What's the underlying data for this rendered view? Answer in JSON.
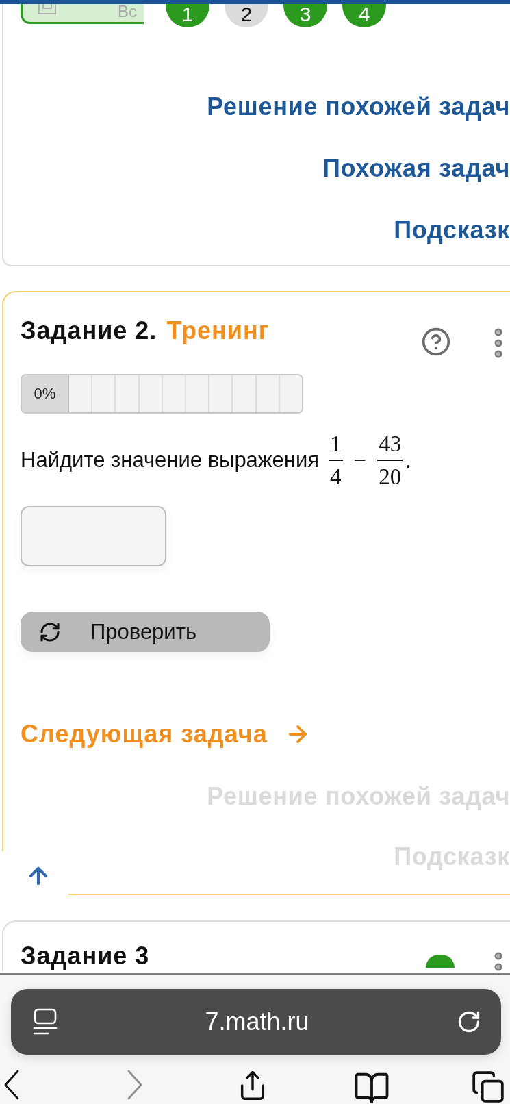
{
  "top_bar": {
    "tab": {
      "label": "Вс"
    },
    "task_numbers": [
      {
        "label": "1",
        "solved": true
      },
      {
        "label": "2",
        "solved": false
      },
      {
        "label": "3",
        "solved": true
      },
      {
        "label": "4",
        "solved": true
      }
    ]
  },
  "task_1": {
    "links": [
      {
        "label": "Решение похожей задач",
        "disabled": false
      },
      {
        "label": "Похожая задач",
        "disabled": false
      },
      {
        "label": "Подсказк",
        "disabled": false
      }
    ]
  },
  "task_2": {
    "title": "Задание 2.",
    "mode": "Тренинг",
    "progress": {
      "label": "0%",
      "segments": [
        {
          "filled": false
        },
        {
          "filled": false
        },
        {
          "filled": false
        },
        {
          "filled": false
        },
        {
          "filled": false
        },
        {
          "filled": false
        },
        {
          "filled": false
        },
        {
          "filled": false
        },
        {
          "filled": false
        },
        {
          "filled": false
        }
      ]
    },
    "question": {
      "text": "Найдите значение выражения",
      "expression": [
        {
          "kind": "fraction",
          "numerator": "1",
          "denominator": "4"
        },
        {
          "kind": "operator",
          "text": "−"
        },
        {
          "kind": "fraction",
          "numerator": "43",
          "denominator": "20"
        },
        {
          "kind": "punctuation",
          "text": "."
        }
      ]
    },
    "check_button": {
      "label": "Проверить",
      "disabled": true
    },
    "next_link": {
      "label": "Следующая задача"
    },
    "links": [
      {
        "label": "Решение похожей задач",
        "disabled": true
      },
      {
        "label": "Подсказк",
        "disabled": true
      }
    ]
  },
  "task_3": {
    "title": "Задание 3",
    "solved": true
  },
  "browser": {
    "url": "7.math.ru",
    "back": {
      "disabled": false
    },
    "forward": {
      "disabled": true
    }
  }
}
